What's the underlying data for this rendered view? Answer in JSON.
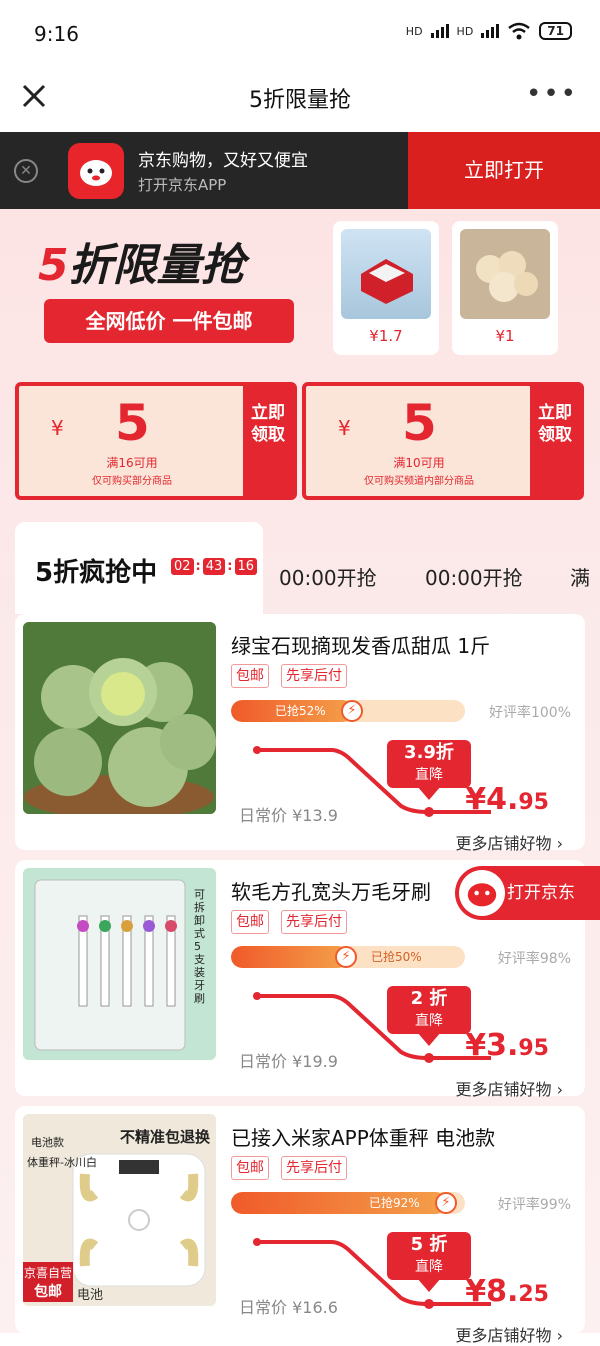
{
  "status": {
    "time": "9:16",
    "battery": "71",
    "hd1": "HD",
    "hd2": "HD"
  },
  "nav": {
    "title": "5折限量抢",
    "more": "•••"
  },
  "banner": {
    "line1": "京东购物，又好又便宜",
    "line2": "打开京东APP",
    "open_btn": "立即打开"
  },
  "hero": {
    "title_five": "5",
    "title_rest": "折限量抢",
    "pill": "全网低价 一件包邮",
    "cards": [
      {
        "price": "¥1.7"
      },
      {
        "price": "¥1"
      }
    ]
  },
  "coupons": [
    {
      "yen": "¥",
      "amount": "5",
      "cond": "满16可用",
      "scope": "仅可购买部分商品",
      "btn": "立即领取"
    },
    {
      "yen": "¥",
      "amount": "5",
      "cond": "满10可用",
      "scope": "仅可购买频道内部分商品",
      "btn": "立即领取"
    }
  ],
  "tabs": {
    "active": "5折疯抢中",
    "countdown": [
      "02",
      "43",
      "16"
    ],
    "others": [
      "00:00开抢",
      "00:00开抢",
      "满"
    ]
  },
  "products": [
    {
      "name": "绿宝石现摘现发香瓜甜瓜 1斤",
      "tags": [
        "包邮",
        "先享后付"
      ],
      "sold_label": "已抢52%",
      "sold_pct": 52,
      "rating": "好评率100%",
      "discount": "3.9折",
      "drop": "直降",
      "regular": "日常价 ¥13.9",
      "price_int": "¥4.",
      "price_dec": "95",
      "more": "更多店铺好物 ›"
    },
    {
      "name": "软毛方孔宽头万毛牙刷",
      "tags": [
        "包邮",
        "先享后付"
      ],
      "sold_label": "已抢50%",
      "sold_pct": 50,
      "rating": "好评率98%",
      "discount": "2 折",
      "drop": "直降",
      "regular": "日常价 ¥19.9",
      "price_int": "¥3.",
      "price_dec": "95",
      "more": "更多店铺好物 ›"
    },
    {
      "name": "已接入米家APP体重秤 电池款",
      "tags": [
        "包邮",
        "先享后付"
      ],
      "sold_label": "已抢92%",
      "sold_pct": 92,
      "rating": "好评率99%",
      "discount": "5 折",
      "drop": "直降",
      "regular": "日常价 ¥16.6",
      "price_int": "¥8.",
      "price_dec": "25",
      "more": "更多店铺好物 ›"
    }
  ],
  "img_text": {
    "brush_side": "可拆卸式5支装牙刷",
    "scale_top": "不精准包退换",
    "scale_l1": "电池款",
    "scale_l2": "体重秤-冰川白",
    "scale_badge": "京喜自营",
    "scale_badge2": "包邮",
    "scale_b2": "电池"
  },
  "float_btn": "打开京东"
}
